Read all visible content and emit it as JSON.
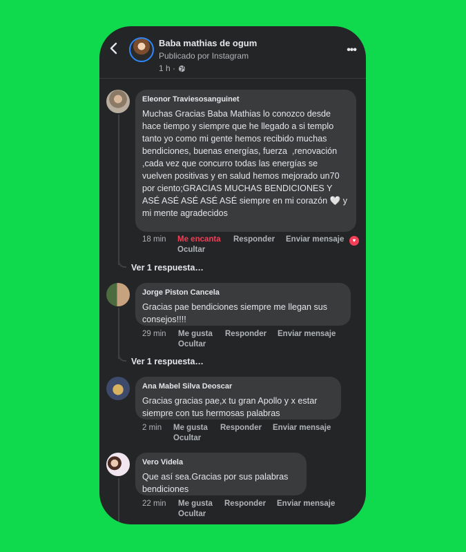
{
  "header": {
    "page_name": "Baba mathias de ogum",
    "subtitle": "Publicado por Instagram",
    "time": "1 h ·"
  },
  "comments": [
    {
      "author": "Eleonor Traviesosanguinet",
      "text": "Muchas Gracias Baba Mathias lo conozco desde hace tiempo y siempre que he llegado a si templo tanto yo como mi gente hemos recibido muchas bendiciones, buenas energías, fuerza  ,renovación ,cada vez que concurro todas las energías se vuelven positivas y en salud hemos mejorado un70 por ciento;GRACIAS MUCHAS BENDICIONES Y  ASÉ ASÉ ASÉ ASÉ ASÉ siempre en mi corazón 🤍 y mi mente agradecidos",
      "time": "18 min",
      "react": "Me encanta",
      "reply": "Responder",
      "message": "Enviar mensaje",
      "hide": "Ocultar",
      "see_replies": "Ver 1 respuesta…"
    },
    {
      "author": "Jorge Piston Cancela",
      "text": "Gracias pae bendiciones siempre me llegan sus consejos!!!!",
      "time": "29 min",
      "react": "Me gusta",
      "reply": "Responder",
      "message": "Enviar mensaje",
      "hide": "Ocultar",
      "see_replies": "Ver 1 respuesta…"
    },
    {
      "author": "Ana Mabel Silva Deoscar",
      "text": "Gracias gracias pae,x tu gran Apollo y x estar siempre con tus hermosas palabras",
      "time": "2 min",
      "react": "Me gusta",
      "reply": "Responder",
      "message": "Enviar mensaje",
      "hide": "Ocultar"
    },
    {
      "author": "Vero Videla",
      "text": "Que así sea.Gracias por sus palabras bendiciones",
      "time": "22 min",
      "react": "Me gusta",
      "reply": "Responder",
      "message": "Enviar mensaje",
      "hide": "Ocultar"
    }
  ],
  "colors": {
    "background": "#0fd94c",
    "card": "#242526",
    "bubble": "#3a3b3c",
    "love": "#f33e58"
  },
  "icons": {
    "back": "chevron-left-icon",
    "privacy": "globe-icon",
    "more": "more-dots-icon",
    "reaction": "heart-icon"
  }
}
